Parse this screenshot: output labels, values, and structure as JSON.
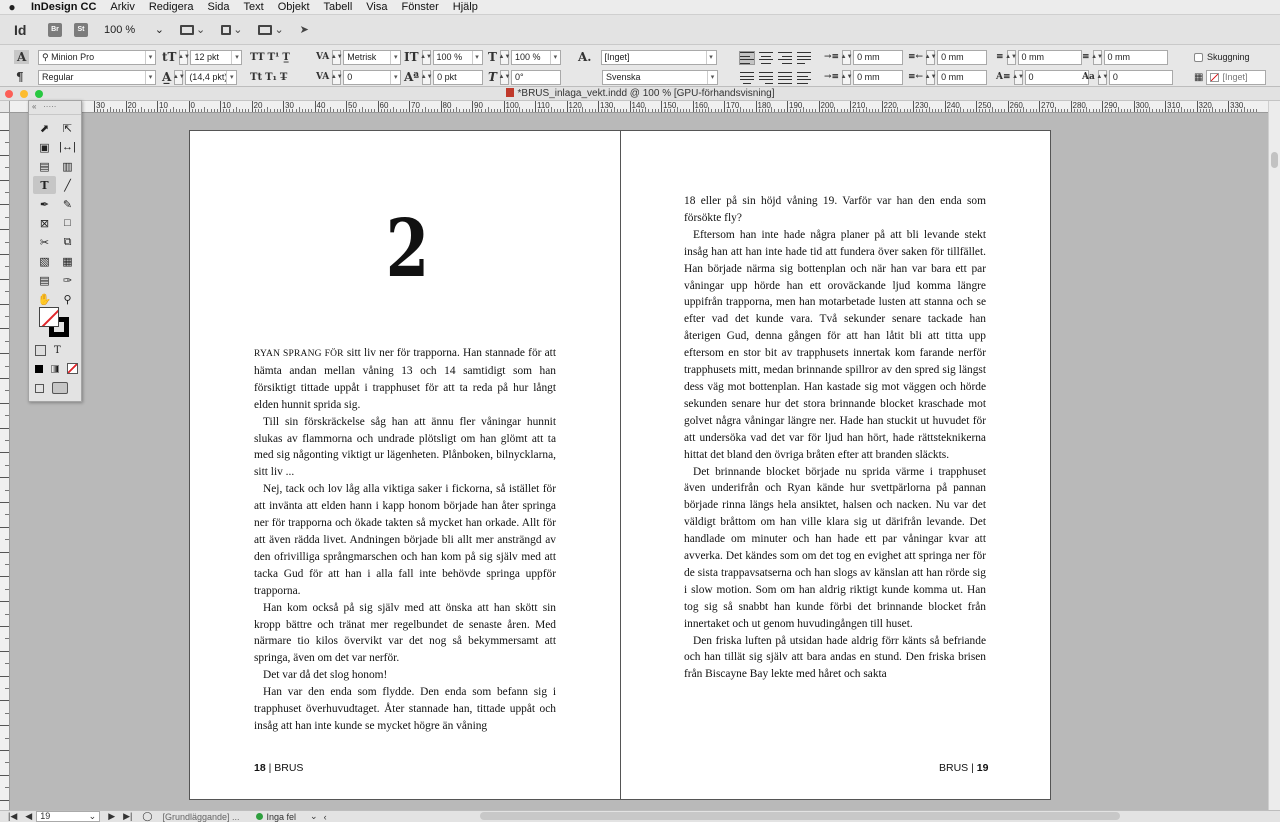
{
  "menubar": {
    "apple": "",
    "items": [
      "InDesign CC",
      "Arkiv",
      "Redigera",
      "Sida",
      "Text",
      "Objekt",
      "Tabell",
      "Visa",
      "Fönster",
      "Hjälp"
    ]
  },
  "appbar": {
    "logo": "Id",
    "bridge": "Br",
    "stock": "St",
    "zoom": "100 %"
  },
  "control": {
    "font_family": "Minion Pro",
    "font_style": "Regular",
    "font_size": "12 pkt",
    "leading": "(14,4 pkt)",
    "kerning": "Metrisk",
    "tracking": "0",
    "vscale": "100 %",
    "hscale": "100 %",
    "baseline": "0 pkt",
    "skew": "0°",
    "char_style": "[Inget]",
    "language": "Svenska",
    "indent_left": "0 mm",
    "indent_first": "0 mm",
    "indent_right": "0 mm",
    "indent_last": "0 mm",
    "space_before": "0 mm",
    "space_after": "0 mm",
    "drop_lines": "0",
    "drop_chars": "0",
    "shading_label": "Skuggning",
    "shading_swatch": "[Inget]"
  },
  "document": {
    "title": "*BRUS_inlaga_vekt.indd @ 100 % [GPU-förhandsvisning]",
    "ruler_h": [
      "30",
      "20",
      "10",
      "0",
      "10",
      "20",
      "30",
      "40",
      "50",
      "60",
      "70",
      "80",
      "90",
      "100",
      "110",
      "120",
      "130",
      "140",
      "150",
      "160",
      "170",
      "180",
      "190",
      "200",
      "210",
      "220",
      "230",
      "240",
      "250",
      "260",
      "270",
      "280",
      "290",
      "300",
      "310",
      "320",
      "330"
    ],
    "ruler_v": [
      "0",
      "1",
      "2",
      "3",
      "4",
      "5",
      "6",
      "7",
      "8",
      "9",
      "10",
      "11",
      "12",
      "13",
      "14",
      "15",
      "16",
      "17",
      "18",
      "19",
      "20",
      "21",
      "22",
      "23",
      "24",
      "25",
      "26",
      "27"
    ]
  },
  "spread": {
    "chapter_number": "2",
    "left_page": {
      "lead_smallcaps": "RYAN SPRANG FÖR",
      "lead_rest": " sitt liv ner för trapporna. Han stannade för att hämta andan mellan våning 13 och 14 samtidigt som han försiktigt tittade uppåt i trapphuset för att ta reda på hur långt elden hunnit sprida sig.",
      "paragraphs": [
        "Till sin förskräckelse såg han att ännu fler våningar hunnit slukas av flammorna och undrade plötsligt om han glömt att ta med sig någonting viktigt ur lägenheten. Plånboken, bilnycklarna, sitt liv ...",
        "Nej, tack och lov låg alla viktiga saker i fickorna, så istället för att invänta att elden hann i kapp honom började han åter springa ner för trapporna och ökade takten så mycket han orkade. Allt för att även rädda livet. Andningen började bli allt mer ansträngd av den ofrivilliga språngmarschen och han kom på sig själv med att tacka Gud för att han i alla fall inte behövde springa uppför trapporna.",
        "Han kom också på sig själv med att önska att han skött sin kropp bättre och tränat mer regelbundet de senaste åren. Med närmare tio kilos övervikt var det nog så bekymmersamt att springa, även om det var nerför.",
        "Det var då det slog honom!",
        "Han var den enda som flydde. Den enda som befann sig i trapphuset överhuvudtaget. Åter stannade han, tittade uppåt och insåg att han inte kunde se mycket högre än våning"
      ],
      "folio_number": "18",
      "folio_title": "BRUS"
    },
    "right_page": {
      "first_line": "18 eller på sin höjd våning 19. Varför var han den enda som försökte fly?",
      "paragraphs": [
        "Eftersom han inte hade några planer på att bli levande stekt insåg han att han inte hade tid att fundera över saken för tillfället. Han började närma sig bottenplan och när han var bara ett par våningar upp hörde han ett oroväckande ljud komma längre uppifrån trapporna, men han motarbetade lusten att stanna och se efter vad det kunde vara. Två sekunder senare tackade han återigen Gud, denna gången för att han låtit bli att titta upp eftersom en stor bit av trapphusets innertak kom farande nerför trapphusets mitt, medan brinnande spillror av den spred sig längst dess väg mot bottenplan. Han kastade sig mot väggen och hörde sekunden senare hur det stora brinnande blocket kraschade mot golvet några våningar längre ner. Hade han stuckit ut huvudet för att undersöka vad det var för ljud han hört, hade rättsteknikerna hittat det bland den övriga bråten efter att branden släckts.",
        "Det brinnande blocket började nu sprida värme i trapphuset även underifrån och Ryan kände hur svettpärlorna på pannan började rinna längs hela ansiktet, halsen och nacken. Nu var det väldigt bråttom om han ville klara sig ut därifrån levande. Det handlade om minuter och han hade ett par våningar kvar att avverka. Det kändes som om det tog en evighet att springa ner för de sista trappavsatserna och han slogs av känslan att han rörde sig i slow motion. Som om han aldrig riktigt kunde komma ut. Han tog sig så snabbt han kunde förbi det brinnande blocket från innertaket och ut genom huvudingången till huset.",
        "Den friska luften på utsidan hade aldrig förr känts så befriande och han tillät sig själv att bara andas en stund. Den friska brisen från Biscayne Bay lekte med håret och sakta"
      ],
      "folio_number": "19",
      "folio_title": "BRUS"
    }
  },
  "statusbar": {
    "page": "19",
    "style": "[Grundläggande] ...",
    "preflight": "Inga fel"
  },
  "colors": {
    "none_swatch": "#e0262b",
    "preflight_ok": "#2e9f3e",
    "light_close": "#fc5f57",
    "light_min": "#fdbc2e",
    "light_max": "#28c840"
  }
}
